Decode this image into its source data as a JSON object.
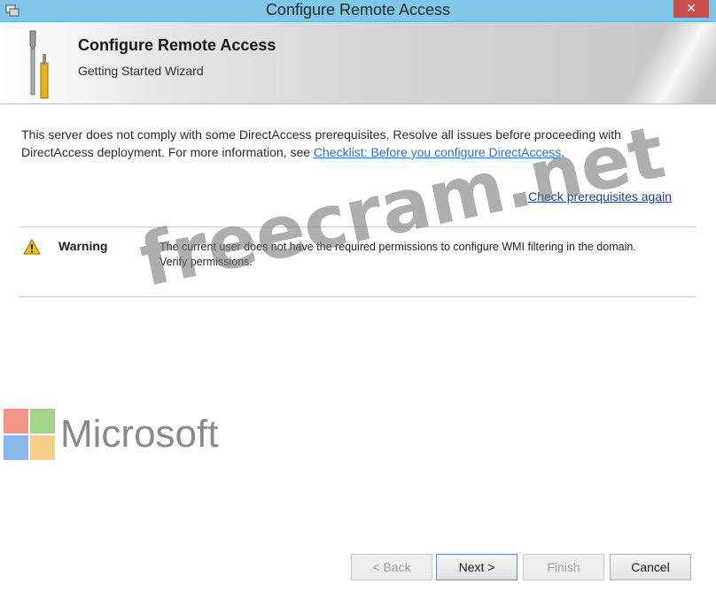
{
  "window": {
    "title": "Configure Remote Access",
    "close_glyph": "✕"
  },
  "header": {
    "title": "Configure Remote Access",
    "subtitle": "Getting Started Wizard"
  },
  "intro": {
    "text_before": "This server does not comply with some DirectAccess prerequisites. Resolve all issues before proceeding with DirectAccess deployment. For more information, see ",
    "link_text": "Checklist: Before you configure DirectAccess",
    "text_after": "."
  },
  "check_link": "Check prerequisites again",
  "warning": {
    "label": "Warning",
    "message": "The current user does not have the required permissions to configure WMI filtering in the domain. Verify permissions."
  },
  "watermarks": {
    "site": "freecram.net",
    "brand": "Microsoft"
  },
  "buttons": {
    "back": "< Back",
    "next": "Next >",
    "finish": "Finish",
    "cancel": "Cancel"
  },
  "icons": {
    "title": "remote-access-icon",
    "header": "tools-icon",
    "warning": "warning-icon",
    "logo": "microsoft-logo"
  },
  "colors": {
    "titlebar": "#7fc6e8",
    "close": "#c7504f",
    "link": "#2a6fcf",
    "warning": "#f2c200"
  }
}
